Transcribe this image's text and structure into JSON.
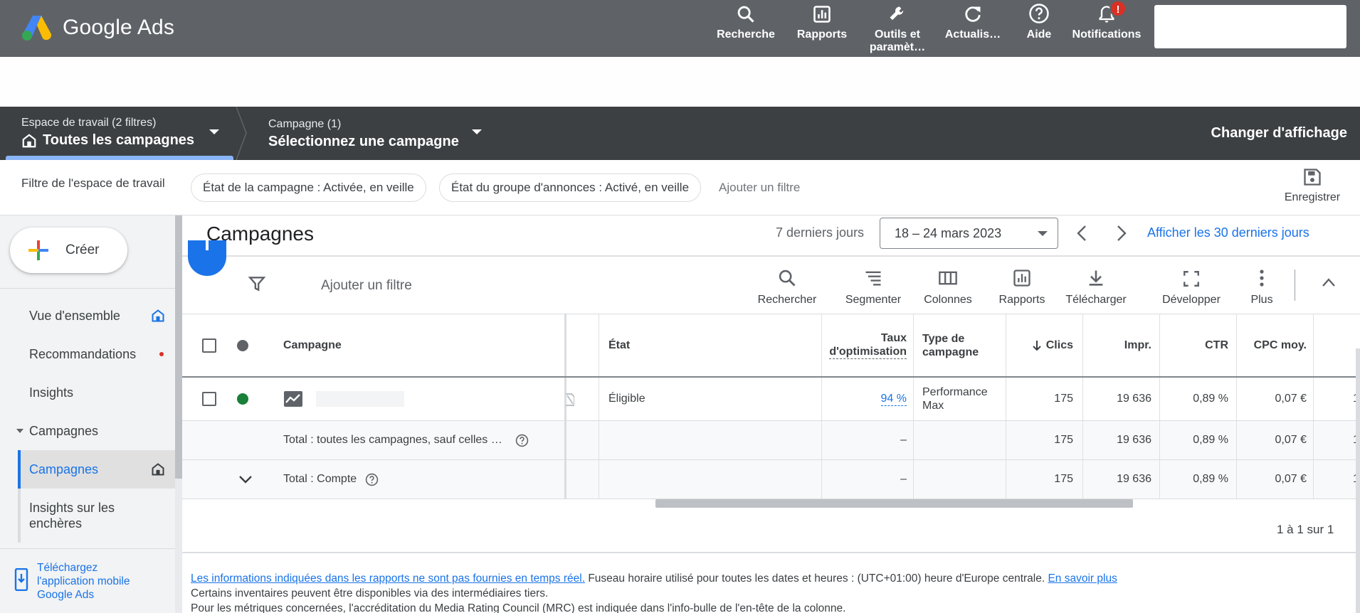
{
  "header": {
    "app_name": "Google Ads",
    "nav": [
      {
        "label": "Recherche",
        "icon": "search-icon"
      },
      {
        "label": "Rapports",
        "icon": "reports-icon"
      },
      {
        "label": "Outils et\nparamèt…",
        "line1": "Outils et",
        "line2": "paramèt…",
        "icon": "wrench-icon"
      },
      {
        "label": "Actualis…",
        "icon": "refresh-icon"
      },
      {
        "label": "Aide",
        "icon": "help-icon"
      },
      {
        "label": "Notifications",
        "icon": "bell-icon",
        "badge": "!"
      }
    ]
  },
  "workspace": {
    "sub": "Espace de travail (2 filtres)",
    "main": "Toutes les campagnes",
    "campaign_sub": "Campagne (1)",
    "campaign_main": "Sélectionnez une campagne",
    "change_view": "Changer d'affichage"
  },
  "filters": {
    "label": "Filtre de l'espace de travail",
    "chips": [
      "État de la campagne : Activée, en veille",
      "État du groupe d'annonces : Activé, en veille"
    ],
    "add": "Ajouter un filtre",
    "save": "Enregistrer"
  },
  "sidebar": {
    "create": "Créer",
    "items": [
      {
        "label": "Vue d'ensemble"
      },
      {
        "label": "Recommandations"
      },
      {
        "label": "Insights"
      },
      {
        "label": "Campagnes"
      },
      {
        "label": "Campagnes"
      },
      {
        "label": "Insights sur les enchères",
        "line1": "Insights sur les",
        "line2": "enchères"
      }
    ],
    "app_link": [
      "Téléchargez",
      "l'application mobile",
      "Google Ads"
    ]
  },
  "main": {
    "title": "Campagnes",
    "date_label": "7 derniers jours",
    "date_range": "18 – 24 mars 2023",
    "show_30": "Afficher les 30 derniers jours",
    "add_filter": "Ajouter un filtre",
    "toolbar": [
      "Rechercher",
      "Segmenter",
      "Colonnes",
      "Rapports",
      "Télécharger",
      "Développer",
      "Plus"
    ],
    "pagination": "1 à 1 sur 1"
  },
  "table": {
    "headers": {
      "campaign": "Campagne",
      "status": "État",
      "opt_1": "Taux",
      "opt_2": "d'optimisation",
      "type_1": "Type de",
      "type_2": "campagne",
      "clicks": "Clics",
      "impr": "Impr.",
      "ctr": "CTR",
      "cpc": "CPC moy."
    },
    "row": {
      "status": "Éligible",
      "opt": "94 %",
      "type_1": "Performance",
      "type_2": "Max",
      "clicks": "175",
      "impr": "19 636",
      "ctr": "0,89 %",
      "cpc": "0,07 €",
      "trunc": "1"
    },
    "total1": {
      "label": "Total : toutes les campagnes, sauf celles …",
      "opt": "–",
      "clicks": "175",
      "impr": "19 636",
      "ctr": "0,89 %",
      "cpc": "0,07 €",
      "trunc": "1"
    },
    "total2": {
      "label": "Total : Compte",
      "opt": "–",
      "clicks": "175",
      "impr": "19 636",
      "ctr": "0,89 %",
      "cpc": "0,07 €",
      "trunc": "1"
    }
  },
  "footer": {
    "link1": "Les informations indiquées dans les rapports ne sont pas fournies en temps réel.",
    "text1": " Fuseau horaire utilisé pour toutes les dates et heures : (UTC+01:00) heure d'Europe centrale. ",
    "link2": "En savoir plus",
    "line2": "Certains inventaires peuvent être disponibles via des intermédiaires tiers.",
    "line3": "Pour les métriques concernées, l'accréditation du Media Rating Council (MRC) est indiquée dans l'info-bulle de l'en-tête de la colonne."
  },
  "colors": {
    "topbar": "#5f6368",
    "workspace": "#3c4043",
    "accent": "#1a73e8",
    "status_green": "#188038",
    "status_dot_header": "#5f6368",
    "badge_red": "#d93025"
  }
}
